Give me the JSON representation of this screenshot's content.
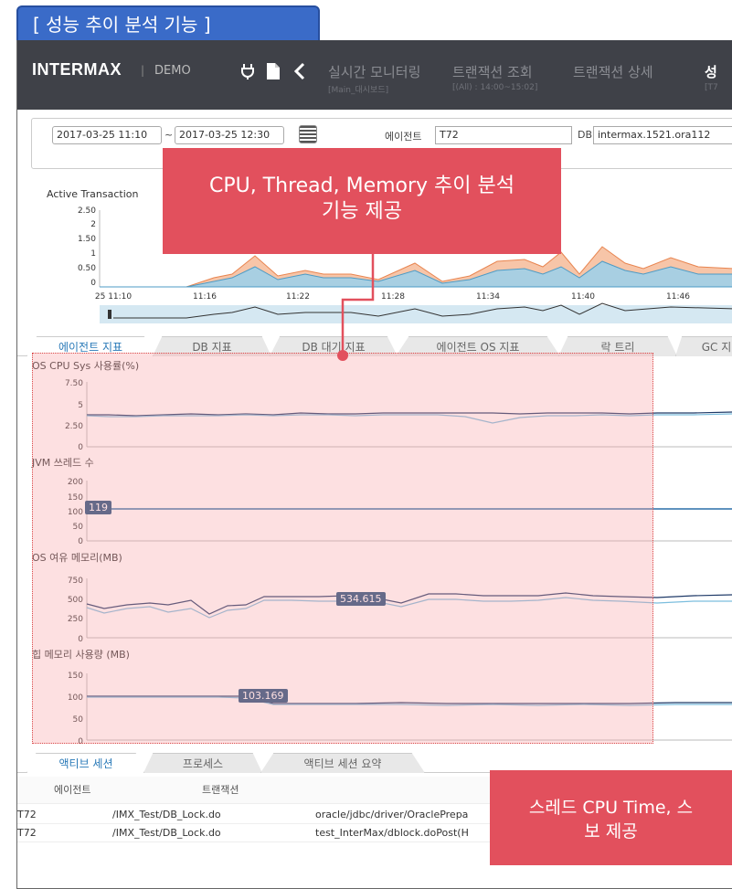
{
  "section_title": "[ 성능 추이 분석 기능 ]",
  "topbar": {
    "brand": "INTERMAX",
    "brand_sep": "|",
    "brand_sub": "DEMO",
    "icons": [
      "plug-icon",
      "document-icon",
      "back-arrow-icon"
    ],
    "nav": [
      {
        "label": "실시간 모니터링",
        "sub": "[Main_대시보드]"
      },
      {
        "label": "트랜잭션 조회",
        "sub": "[(All) : 14:00~15:02]"
      },
      {
        "label": "트랜잭션 상세",
        "sub": ""
      },
      {
        "label": "성",
        "sub": "[T7"
      }
    ]
  },
  "filter": {
    "from": "2017-03-25 11:10",
    "tilde": "~",
    "to": "2017-03-25 12:30",
    "agent_label": "에이전트",
    "agent_value": "T72",
    "db_label": "DB",
    "db_value": "intermax.1521.ora112"
  },
  "active_transaction": {
    "title": "Active Transaction",
    "y_ticks": [
      "2.50",
      "2",
      "1.50",
      "1",
      "0.50",
      "0"
    ],
    "x_ticks": [
      "25 11:10",
      "11:16",
      "11:22",
      "11:28",
      "11:34",
      "11:40",
      "11:46"
    ]
  },
  "tabs": [
    {
      "label": "에이전트 지표",
      "active": true
    },
    {
      "label": "DB 지표"
    },
    {
      "label": "DB 대기 지표"
    },
    {
      "label": "에이전트 OS 지표"
    },
    {
      "label": "락 트리"
    },
    {
      "label": "GC 지"
    }
  ],
  "metrics": [
    {
      "title": "OS CPU Sys 사용률(%)",
      "ticks": [
        "7.50",
        "5",
        "2.50",
        "0"
      ]
    },
    {
      "title": "JVM 쓰레드 수",
      "ticks": [
        "200",
        "150",
        "100",
        "50",
        "0"
      ],
      "bubble": "119"
    },
    {
      "title": "OS 여유 메모리(MB)",
      "ticks": [
        "750",
        "500",
        "250",
        "0"
      ],
      "bubble": "534.615"
    },
    {
      "title": "힙 메모리 사용량 (MB)",
      "ticks": [
        "150",
        "100",
        "50",
        "0"
      ],
      "bubble": "103.169"
    }
  ],
  "callout_top": {
    "line1": "CPU, Thread, Memory 추이 분석",
    "line2": "기능 제공"
  },
  "callout_bottom": {
    "line1": "스레드 CPU Time, 스",
    "line2": "보 제공"
  },
  "bottom_tabs": [
    "액티브 세션",
    "프로세스",
    "액티브 세션 요약"
  ],
  "bottom_table": {
    "headers": [
      "에이전트",
      "트랜잭션"
    ],
    "rows": [
      {
        "agent": "T72",
        "txn": "/IMX_Test/DB_Lock.do",
        "detail": "oracle/jdbc/driver/OraclePrepa"
      },
      {
        "agent": "T72",
        "txn": "/IMX_Test/DB_Lock.do",
        "detail": "test_InterMax/dblock.doPost(H"
      }
    ]
  },
  "colors": {
    "accent": "#2a7ab8",
    "callout": "#e2505d",
    "topbar": "#3f4148",
    "section": "#3a6bc8"
  }
}
